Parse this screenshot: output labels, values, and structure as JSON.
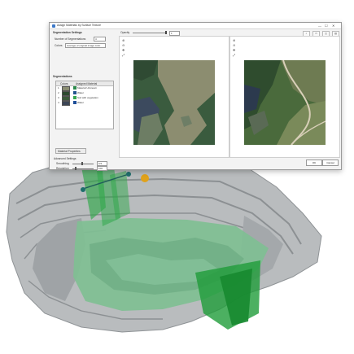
{
  "dialog": {
    "title": "Assign Materials by Surface Texture",
    "win_min": "—",
    "win_max": "☐",
    "win_close": "✕"
  },
  "left": {
    "section_title": "Segmentation Settings",
    "num_segments_label": "Number of Segmentations",
    "num_segments_value": "4",
    "colors_label": "Colors",
    "colors_value": "Average of original image color",
    "segmentations_title": "Segmentations",
    "table_headers": [
      "Colors",
      "Assigned Material"
    ],
    "rows": [
      {
        "index": "1",
        "color": "#8a8d72",
        "swatch": "#2b8a4b",
        "name": "Material Unknown"
      },
      {
        "index": "2",
        "color": "#2d4a30",
        "swatch": "#23548f",
        "name": "Water"
      },
      {
        "index": "3",
        "color": "#3b5a3a",
        "swatch": "#36a64f",
        "name": "Soil with vegetation"
      },
      {
        "index": "4",
        "color": "#3c4556",
        "swatch": "#1f4f99",
        "name": "Water"
      }
    ],
    "material_button": "Material Properties",
    "advanced_title": "Advanced Settings",
    "smoothing_label": "Smoothing",
    "smoothing_value": "0.5",
    "resolution_label": "Resolution",
    "resolution_value": "100"
  },
  "viewers": {
    "opacity_label": "Opacity",
    "opacity_value": "1",
    "tools": [
      "⊕",
      "⊖",
      "✥",
      "⤢"
    ]
  },
  "footer": {
    "ok": "OK",
    "cancel": "Cancel"
  }
}
